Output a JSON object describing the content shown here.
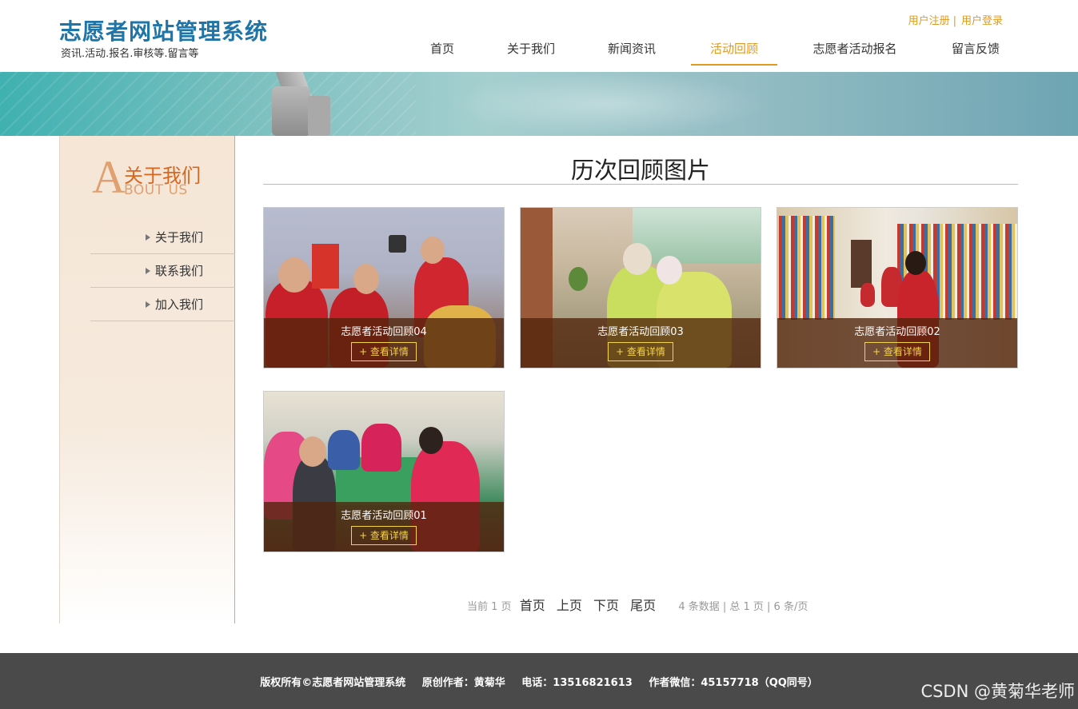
{
  "site": {
    "title": "志愿者网站管理系统",
    "subtitle": "资讯.活动.报名.审核等.留言等"
  },
  "top_links": {
    "register": "用户注册",
    "separator": "|",
    "login": "用户登录"
  },
  "nav": {
    "items": [
      {
        "label": "首页"
      },
      {
        "label": "关于我们"
      },
      {
        "label": "新闻资讯"
      },
      {
        "label": "活动回顾",
        "active": true
      },
      {
        "label": "志愿者活动报名"
      },
      {
        "label": "留言反馈"
      }
    ]
  },
  "sidebar": {
    "big_letter": "A",
    "title": "关于我们",
    "subtitle": "BOUT US",
    "items": [
      {
        "label": "关于我们"
      },
      {
        "label": "联系我们"
      },
      {
        "label": "加入我们"
      }
    ]
  },
  "main": {
    "title": "历次回顾图片",
    "cards": [
      {
        "caption": "志愿者活动回顾04",
        "button": "+ 查看详情"
      },
      {
        "caption": "志愿者活动回顾03",
        "button": "+ 查看详情"
      },
      {
        "caption": "志愿者活动回顾02",
        "button": "+ 查看详情"
      },
      {
        "caption": "志愿者活动回顾01",
        "button": "+ 查看详情"
      }
    ]
  },
  "pager": {
    "current": "当前 1 页",
    "first": "首页",
    "prev": "上页",
    "next": "下页",
    "last": "尾页",
    "info": "4 条数据 | 总 1 页 | 6 条/页"
  },
  "footer": {
    "copyright": "版权所有©志愿者网站管理系统",
    "author": "原创作者：黄菊华",
    "phone": "电话：13516821613",
    "wechat": "作者微信：45157718（QQ同号）"
  },
  "watermark": "CSDN @黄菊华老师",
  "colors": {
    "brand_blue": "#1f74a8",
    "accent_orange": "#e39a1c",
    "sidebar_title": "#d9661f",
    "footer_bg": "#4a4a4a",
    "button_yellow": "#f5d44a"
  }
}
